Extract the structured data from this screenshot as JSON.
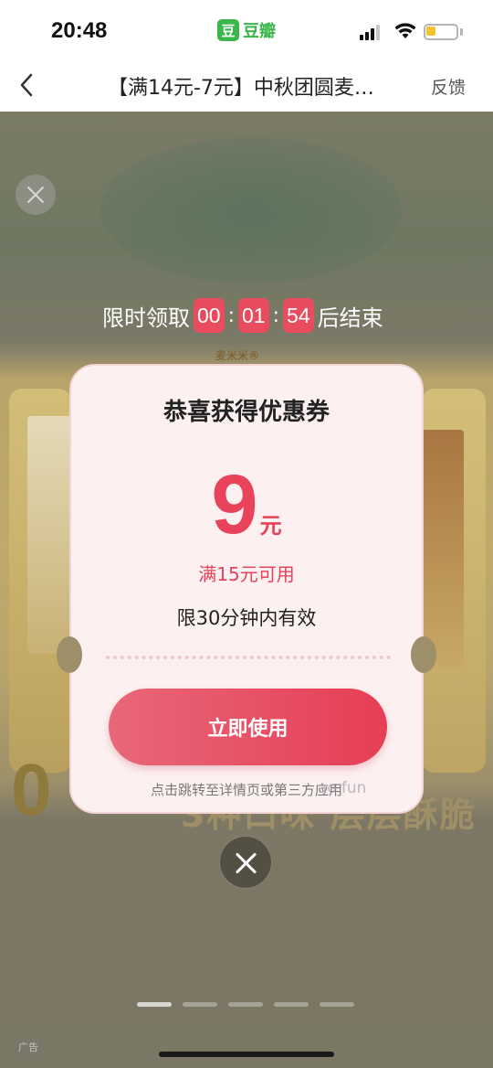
{
  "status_bar": {
    "time": "20:48",
    "app_logo_char": "豆",
    "app_name": "豆瓣",
    "battery_color": "#f4c430"
  },
  "nav": {
    "title": "【满14元-7元】中秋团圆麦…",
    "feedback_label": "反馈"
  },
  "countdown": {
    "prefix": "限时领取",
    "hours": "00",
    "minutes": "01",
    "seconds": "54",
    "separator": ":",
    "suffix": "后结束"
  },
  "background_ad": {
    "brand_text": "麦米米®",
    "big_number": "0",
    "banner_text": "3种口味 层层酥脆",
    "ad_tag": "广告"
  },
  "coupon": {
    "title": "恭喜获得优惠券",
    "amount": "9",
    "unit": "元",
    "condition": "满15元可用",
    "validity": "限30分钟内有效",
    "button_label": "立即使用",
    "hint": "点击跳转至详情页或第三方应用",
    "accent_color": "#e8435a"
  },
  "watermark": "ao.fun",
  "pagination": {
    "count": 5,
    "active_index": 0
  }
}
